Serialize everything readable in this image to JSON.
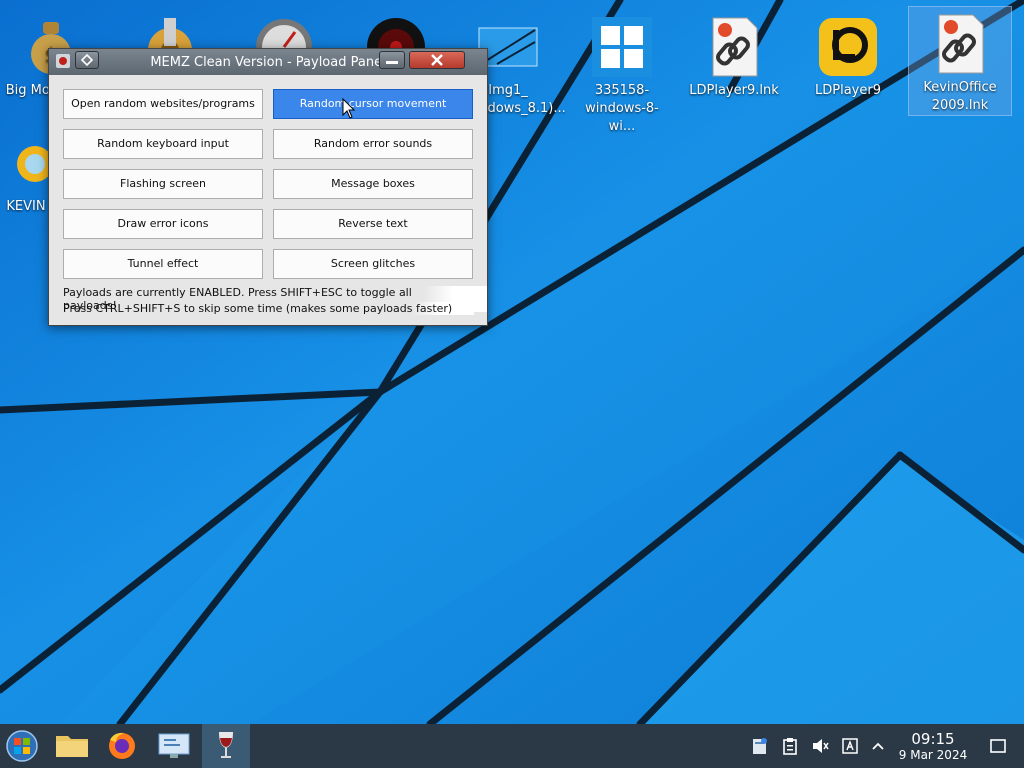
{
  "desktop": {
    "icons": [
      {
        "label": "Big Money Dis",
        "icon": "money-bag-icon"
      },
      {
        "label": "",
        "icon": "gear-settings-icon"
      },
      {
        "label": "",
        "icon": "speedometer-icon"
      },
      {
        "label": "",
        "icon": "dark-disc-icon"
      },
      {
        "label": "Img1_ (Windows_8.1)...",
        "icon": "image-file-icon"
      },
      {
        "label": "335158-windows-8-wi...",
        "icon": "windows-logo-icon"
      },
      {
        "label": "LDPlayer9.lnk",
        "icon": "shortcut-file-icon"
      },
      {
        "label": "LDPlayer9",
        "icon": "ldplayer-icon"
      },
      {
        "label": "KevinOffice 2009.lnk",
        "icon": "shortcut-file-icon"
      },
      {
        "label": "KEVIN",
        "icon": "sun-icon"
      }
    ]
  },
  "window": {
    "title": "MEMZ Clean Version - Payload Panel",
    "buttons": [
      {
        "label": "Open random websites/programs",
        "active": false
      },
      {
        "label": "Random cursor movement",
        "active": true
      },
      {
        "label": "Random keyboard input",
        "active": false
      },
      {
        "label": "Random error sounds",
        "active": false
      },
      {
        "label": "Flashing screen",
        "active": false
      },
      {
        "label": "Message boxes",
        "active": false
      },
      {
        "label": "Draw error icons",
        "active": false
      },
      {
        "label": "Reverse text",
        "active": false
      },
      {
        "label": "Tunnel effect",
        "active": false
      },
      {
        "label": "Screen glitches",
        "active": false
      }
    ],
    "status_line_1": "Payloads are currently ENABLED. Press SHIFT+ESC to toggle all payloads!",
    "status_line_2": "Press CTRL+SHIFT+S to skip some time (makes some payloads faster)"
  },
  "taskbar": {
    "items": [
      {
        "icon": "start-orb-icon"
      },
      {
        "icon": "folder-icon"
      },
      {
        "icon": "firefox-icon"
      },
      {
        "icon": "remote-desktop-icon"
      },
      {
        "icon": "wine-glass-icon",
        "active": true
      }
    ],
    "tray": [
      "notifier-icon",
      "clipboard-icon",
      "volume-muted-icon",
      "keyboard-layout-icon",
      "chevron-up-icon",
      "show-desktop-icon"
    ],
    "clock": {
      "time": "09:15",
      "date": "9 Mar 2024"
    }
  },
  "colors": {
    "accent": "#3a86ea",
    "taskbar": "#2b3946",
    "wallpaper": "#1a8fe0"
  }
}
